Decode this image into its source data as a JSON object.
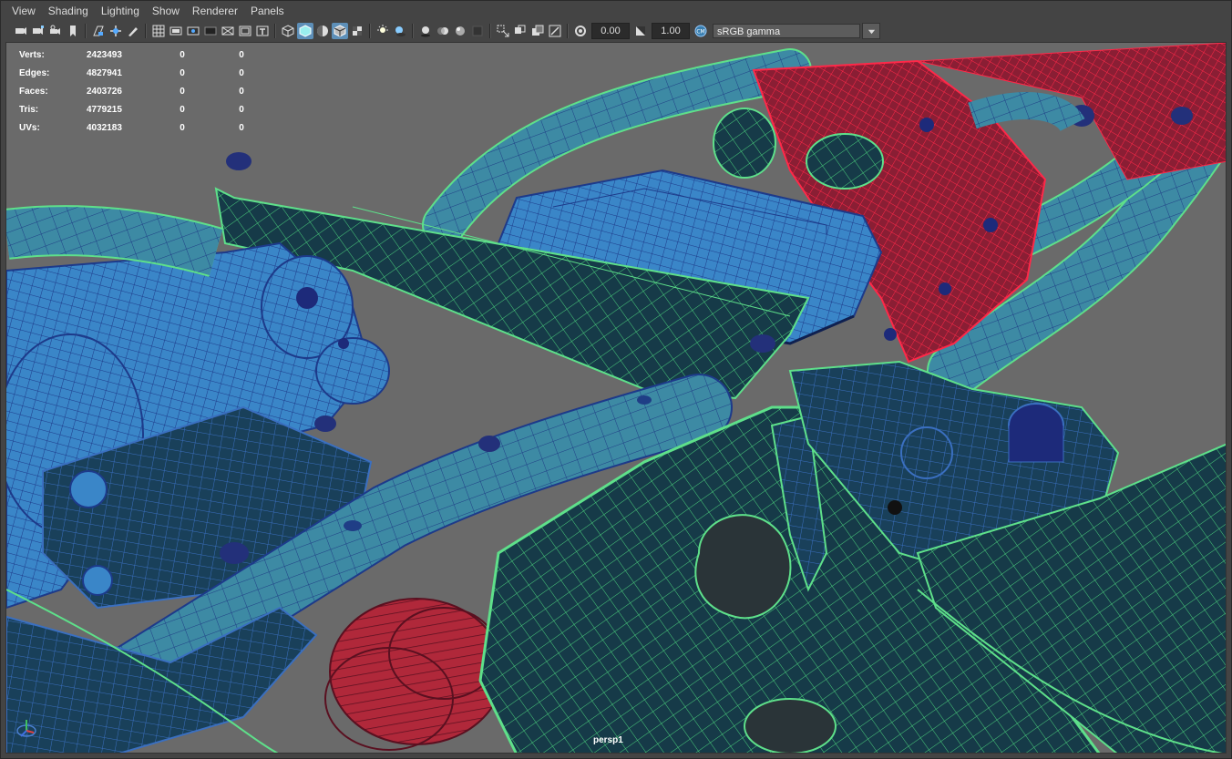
{
  "menubar": {
    "items": [
      "View",
      "Shading",
      "Lighting",
      "Show",
      "Renderer",
      "Panels"
    ]
  },
  "toolbar": {
    "icons": [
      "camera-select-icon",
      "camera-attributes-icon",
      "camera-lock-icon",
      "bookmark-icon",
      "image-plane-icon",
      "two-d-pan-zoom-icon",
      "grease-pencil-icon",
      "grid-icon",
      "film-gate-icon",
      "resolution-gate-icon",
      "gate-mask-icon",
      "field-chart-icon",
      "safe-action-icon",
      "safe-title-icon",
      "wireframe-icon",
      "smooth-shade-icon",
      "use-default-material-icon",
      "wireframe-on-shaded-icon",
      "textured-icon",
      "use-all-lights-icon",
      "shadows-icon",
      "screen-space-ao-icon",
      "motion-blur-icon",
      "multisample-aa-icon",
      "depth-of-field-icon",
      "isolate-select-icon",
      "xray-icon",
      "xray-active-components-icon",
      "xray-joints-icon",
      "exposure-icon",
      "gamma-icon",
      "view-transform-icon"
    ],
    "exposure_value": "0.00",
    "gamma_value": "1.00",
    "color_management": "sRGB gamma"
  },
  "hud": {
    "rows": [
      {
        "label": "Verts:",
        "v1": "2423493",
        "v2": "0",
        "v3": "0"
      },
      {
        "label": "Edges:",
        "v1": "4827941",
        "v2": "0",
        "v3": "0"
      },
      {
        "label": "Faces:",
        "v1": "2403726",
        "v2": "0",
        "v3": "0"
      },
      {
        "label": "Tris:",
        "v1": "4779215",
        "v2": "0",
        "v3": "0"
      },
      {
        "label": "UVs:",
        "v1": "4032183",
        "v2": "0",
        "v3": "0"
      }
    ]
  },
  "viewport": {
    "camera_label": "persp1"
  },
  "colors": {
    "ui_background": "#444444",
    "viewport_background": "#6a6a6a",
    "wire_green": "#5ee08a",
    "wire_blue": "#2a3f9a",
    "wire_red": "#ff2040",
    "mesh_teal": "#3b8aa6",
    "mesh_blue": "#3a86c8",
    "mesh_red": "#b02a3a",
    "active_button": "#5d8fb8"
  }
}
